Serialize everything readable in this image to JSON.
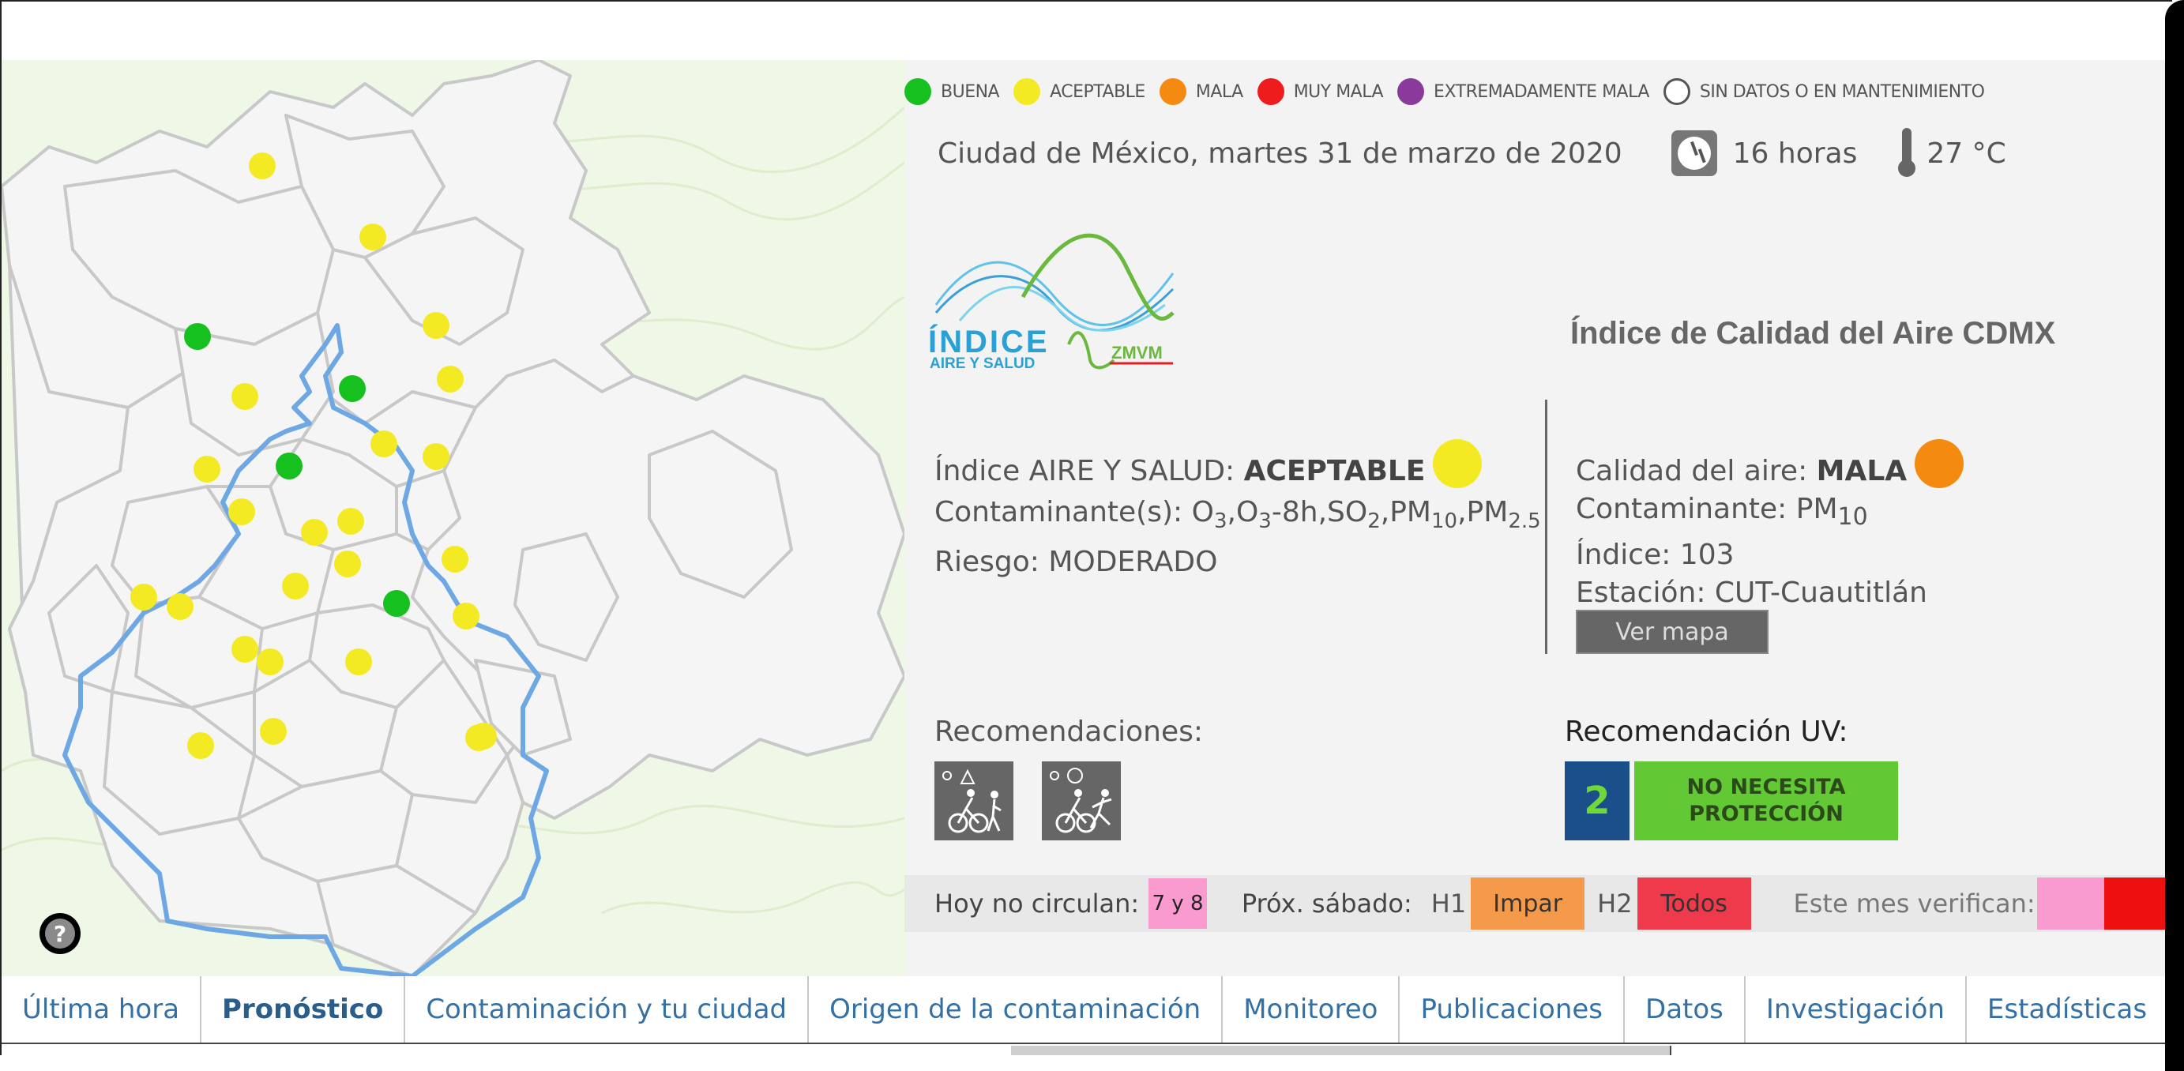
{
  "legend": [
    {
      "label": "BUENA",
      "color": "#16c01e"
    },
    {
      "label": "ACEPTABLE",
      "color": "#f4ea24"
    },
    {
      "label": "MALA",
      "color": "#f58a10"
    },
    {
      "label": "MUY MALA",
      "color": "#ee1c1c"
    },
    {
      "label": "EXTREMADAMENTE MALA",
      "color": "#8a3a9a"
    },
    {
      "label": "SIN DATOS O EN MANTENIMIENTO",
      "color": "none"
    }
  ],
  "header": {
    "date": "Ciudad de México, martes 31 de marzo de 2020",
    "hour": "16 horas",
    "temp": "27 °C"
  },
  "logo": {
    "text_main": "ÍNDICE",
    "text_sub": "AIRE Y SALUD",
    "text_zmvm": "ZMVM"
  },
  "title": "Índice de Calidad del Aire CDMX",
  "indice": {
    "prefix": "Índice AIRE Y SALUD: ",
    "value": "ACEPTABLE",
    "color": "#f4ea24",
    "contaminantes_prefix": "Contaminante(s): ",
    "contaminantes": [
      {
        "base": "O",
        "sub": "3"
      },
      {
        "base": "O",
        "sub": "3",
        "suffix": "-8h"
      },
      {
        "base": "SO",
        "sub": "2"
      },
      {
        "base": "PM",
        "sub": "10"
      },
      {
        "base": "PM",
        "sub": "2.5"
      }
    ],
    "riesgo": "Riesgo: MODERADO"
  },
  "calidad": {
    "prefix": "Calidad del aire: ",
    "value": "MALA",
    "color": "#f58a10",
    "contaminante_prefix": "Contaminante: PM",
    "contaminante_sub": "10",
    "indice": "Índice: 103",
    "estacion": "Estación: CUT-Cuautitlán",
    "button": "Ver mapa"
  },
  "recomendaciones": {
    "label": "Recomendaciones:"
  },
  "uv": {
    "label": "Recomendación UV:",
    "value": "2",
    "text_line1": "NO NECESITA",
    "text_line2": "PROTECCIÓN"
  },
  "strip": {
    "hoy_label": "Hoy no circulan:",
    "hoy_value": "7 y 8",
    "prox_label": "Próx. sábado:",
    "h1": "H1",
    "h1_value": "Impar",
    "h2": "H2",
    "h2_value": "Todos",
    "verifican_label": "Este mes verifican:",
    "verifican_colors": [
      "#f99bcf",
      "#ee0f0f"
    ]
  },
  "nav": [
    "Última hora",
    "Pronóstico",
    "Contaminación y tu ciudad",
    "Origen de la contaminación",
    "Monitoreo",
    "Publicaciones",
    "Datos",
    "Investigación",
    "Estadísticas"
  ],
  "nav_active": "Pronóstico",
  "map_stations": [
    {
      "color": "#f4ea24"
    },
    {
      "color": "#f4ea24"
    },
    {
      "color": "#16c01e"
    },
    {
      "color": "#f4ea24"
    },
    {
      "color": "#f4ea24"
    },
    {
      "color": "#f4ea24"
    },
    {
      "color": "#16c01e"
    },
    {
      "color": "#f4ea24"
    },
    {
      "color": "#f4ea24"
    },
    {
      "color": "#16c01e"
    },
    {
      "color": "#f4ea24"
    },
    {
      "color": "#f4ea24"
    },
    {
      "color": "#f4ea24"
    },
    {
      "color": "#f4ea24"
    },
    {
      "color": "#f4ea24"
    },
    {
      "color": "#f4ea24"
    },
    {
      "color": "#f4ea24"
    },
    {
      "color": "#16c01e"
    },
    {
      "color": "#f4ea24"
    },
    {
      "color": "#f4ea24"
    },
    {
      "color": "#f4ea24"
    },
    {
      "color": "#f4ea24"
    },
    {
      "color": "#f4ea24"
    },
    {
      "color": "#f4ea24"
    },
    {
      "color": "#f4ea24"
    },
    {
      "color": "#f4ea24"
    },
    {
      "color": "#f4ea24"
    },
    {
      "color": "#f4ea24"
    }
  ]
}
